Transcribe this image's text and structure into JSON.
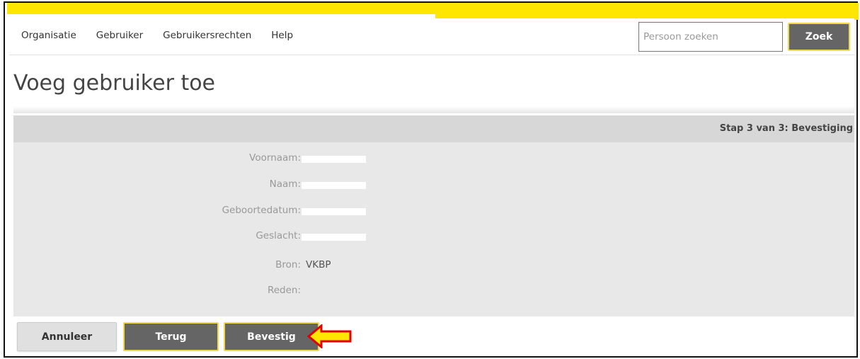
{
  "colors": {
    "accent_yellow": "#ffe600",
    "button_dark": "#656565",
    "panel_bg": "#e8e8e8",
    "header_bg": "#d7d7d7",
    "arrow_fill": "#ffe600",
    "arrow_stroke": "#e00000"
  },
  "nav": {
    "items": [
      "Organisatie",
      "Gebruiker",
      "Gebruikersrechten",
      "Help"
    ]
  },
  "search": {
    "placeholder": "Persoon zoeken",
    "button_label": "Zoek"
  },
  "page": {
    "title": "Voeg gebruiker toe"
  },
  "form": {
    "step": "Stap 3 van 3: Bevestiging",
    "fields": [
      {
        "label": "Voornaam:",
        "value": "",
        "redacted": true
      },
      {
        "label": "Naam:",
        "value": "",
        "redacted": true
      },
      {
        "label": "Geboortedatum:",
        "value": "",
        "redacted": true
      },
      {
        "label": "Geslacht:",
        "value": "",
        "redacted": true
      },
      {
        "label": "Bron:",
        "value": "VKBP",
        "redacted": false
      },
      {
        "label": "Reden:",
        "value": "",
        "redacted": false
      }
    ]
  },
  "actions": {
    "cancel": "Annuleer",
    "back": "Terug",
    "confirm": "Bevestig"
  },
  "annotation": {
    "icon": "arrow-left-icon"
  }
}
